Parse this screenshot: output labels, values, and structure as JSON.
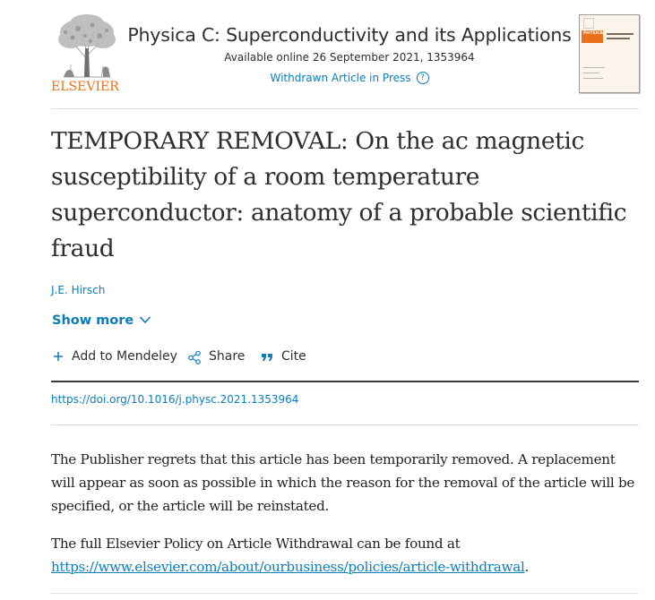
{
  "header": {
    "publisher_logo_text": "ELSEVIER",
    "journal_title": "Physica C: Superconductivity and its Applications",
    "available_online": "Available online 26 September 2021, 1353964",
    "status_link": "Withdrawn Article in Press",
    "help_icon_glyph": "?",
    "cover": {
      "journal_short": "PHYSICA",
      "journal_sub": ""
    }
  },
  "article": {
    "title": "TEMPORARY REMOVAL: On the ac magnetic susceptibility of a room temperature superconductor: anatomy of a probable scientific fraud",
    "author": "J.E. Hirsch",
    "show_more": "Show more",
    "actions": [
      {
        "icon": "plus-icon",
        "label": "Add to Mendeley"
      },
      {
        "icon": "share-icon",
        "label": "Share"
      },
      {
        "icon": "quote-icon",
        "label": "Cite"
      }
    ],
    "doi": "https://doi.org/10.1016/j.physc.2021.1353964"
  },
  "body": {
    "notice": "The Publisher regrets that this article has been temporarily removed. A replacement will appear as soon as possible in which the reason for the removal of the article will be specified, or the article will be reinstated.",
    "policy_intro": "The full Elsevier Policy on Article Withdrawal can be found at",
    "policy_link": "https://www.elsevier.com/about/ourbusiness/policies/article-withdrawal",
    "policy_end": "."
  },
  "colors": {
    "link": "#0c7dbb",
    "brand_orange": "#e9711c",
    "text": "#1f1f1f"
  }
}
